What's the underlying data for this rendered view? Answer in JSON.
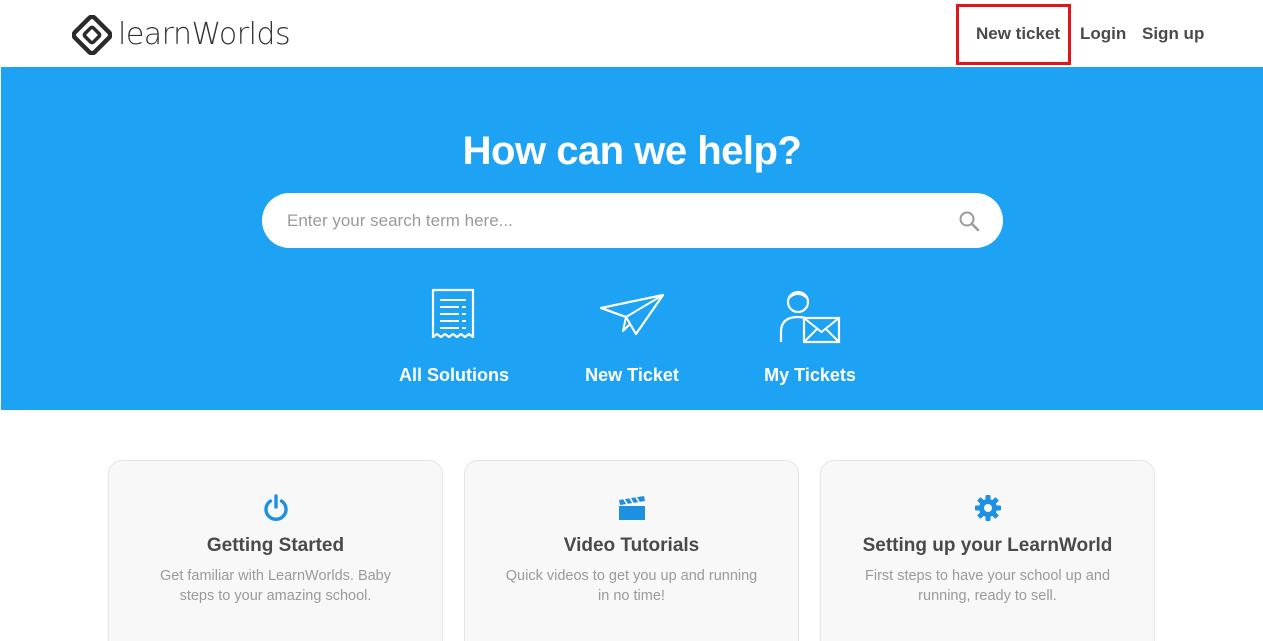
{
  "brand": {
    "name": "learnWorlds"
  },
  "nav": {
    "new_ticket": "New ticket",
    "login": "Login",
    "signup": "Sign up"
  },
  "hero": {
    "title": "How can we help?",
    "search_placeholder": "Enter your search term here...",
    "links": [
      {
        "label": "All Solutions",
        "icon": "document-list-icon"
      },
      {
        "label": "New Ticket",
        "icon": "paper-plane-icon"
      },
      {
        "label": "My Tickets",
        "icon": "user-envelope-icon"
      }
    ]
  },
  "cards": [
    {
      "title": "Getting Started",
      "description": "Get familiar with LearnWorlds. Baby steps to your amazing school.",
      "icon": "power-icon"
    },
    {
      "title": "Video Tutorials",
      "description": "Quick videos to get you up and running in no time!",
      "icon": "clapperboard-icon"
    },
    {
      "title": "Setting up your LearnWorld",
      "description": "First steps to have your school up and running, ready to sell.",
      "icon": "gear-icon"
    }
  ],
  "colors": {
    "hero_bg": "#1ea2f3",
    "accent": "#1e90e0",
    "highlight": "#e0161c"
  }
}
